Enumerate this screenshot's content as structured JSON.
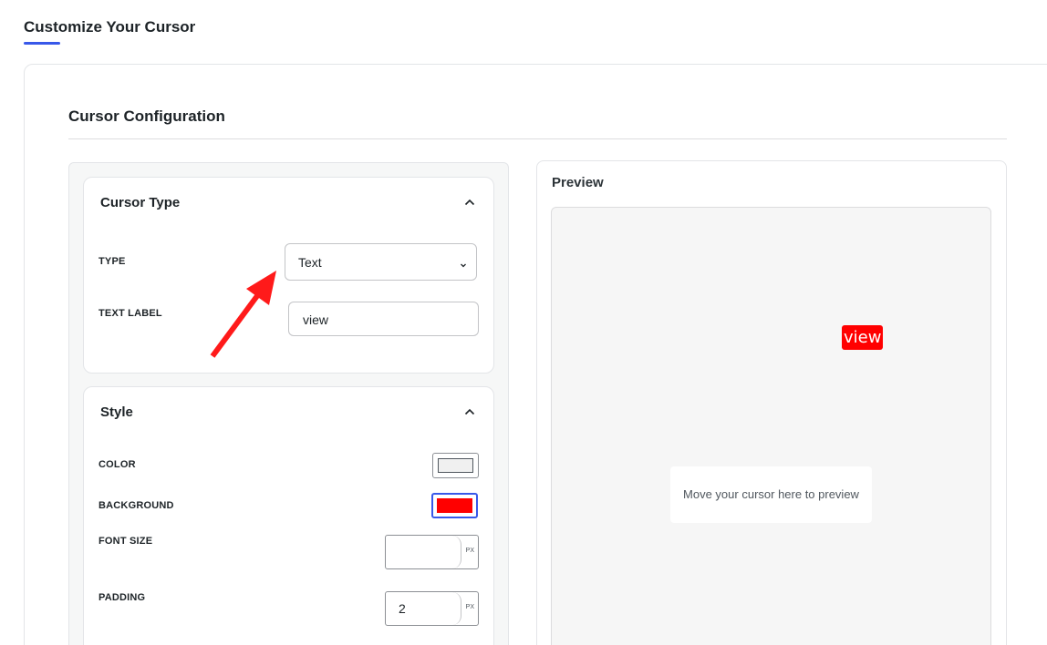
{
  "page": {
    "title": "Customize Your Cursor"
  },
  "config": {
    "title": "Cursor Configuration"
  },
  "cursor_type_panel": {
    "title": "Cursor Type",
    "toggle_icon": "chevron-up-icon",
    "type": {
      "label": "TYPE",
      "selected": "Text",
      "icon": "chevron-down-icon"
    },
    "text_label": {
      "label": "TEXT LABEL",
      "value": "view"
    }
  },
  "style_panel": {
    "title": "Style",
    "toggle_icon": "chevron-up-icon",
    "color": {
      "label": "COLOR",
      "value": "#f0f0f0"
    },
    "background": {
      "label": "BACKGROUND",
      "value": "#ff0000"
    },
    "font_size": {
      "label": "FONT SIZE",
      "value": "",
      "unit": "PX"
    },
    "padding": {
      "label": "PADDING",
      "value": "2",
      "unit": "PX"
    }
  },
  "preview": {
    "title": "Preview",
    "cursor_text": "view",
    "cursor_text_color": "#ffffff",
    "cursor_bg_color": "#ff0000",
    "hint": "Move your cursor here to preview"
  },
  "annotation": {
    "icon": "red-arrow-icon",
    "color": "#ff1a1a"
  },
  "colors": {
    "accent": "#3858e9"
  }
}
